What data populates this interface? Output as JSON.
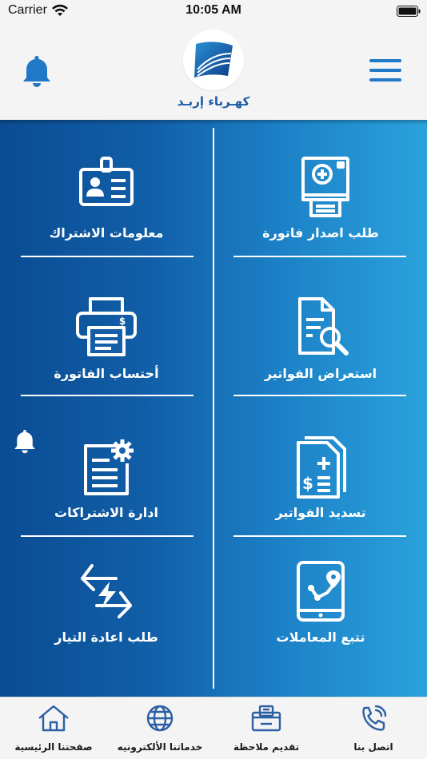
{
  "status_bar": {
    "carrier": "Carrier",
    "time": "10:05 AM"
  },
  "header": {
    "logo_text": "كهـرباء إربـد",
    "icons": [
      "notification-bell-icon",
      "hamburger-menu-icon",
      "company-logo"
    ]
  },
  "colors": {
    "accent": "#1f78c8",
    "panel_left": "#0a4c93",
    "panel_right": "#2aa2dc",
    "logo_blue": "#1b5aa8"
  },
  "services": {
    "request_invoice": {
      "label": "طلب اصدار فاتورة",
      "icon": "invoice-printer-add-icon"
    },
    "subscription_info": {
      "label": "معلومات الاشتراك",
      "icon": "id-card-icon"
    },
    "view_invoices": {
      "label": "استعراض الفواتير",
      "icon": "document-search-icon"
    },
    "calculate_invoice": {
      "label": "أحتساب الفاتورة",
      "icon": "printer-dollar-icon"
    },
    "pay_invoices": {
      "label": "تسديد الفواتير",
      "icon": "bill-payment-icon"
    },
    "manage_subscriptions": {
      "label": "ادارة الاشتراكات",
      "icon": "document-settings-icon"
    },
    "track_transactions": {
      "label": "تتبع المعاملات",
      "icon": "tablet-route-icon"
    },
    "reconnect_power": {
      "label": "طلب اعادة التيار",
      "icon": "power-reconnect-icon"
    }
  },
  "bottom_nav": {
    "contact": {
      "label": "اتصل بنا",
      "icon": "phone-icon"
    },
    "feedback": {
      "label": "تقديم ملاحظة",
      "icon": "feedback-box-icon"
    },
    "eservices": {
      "label": "خدماتنا الألكترونيه",
      "icon": "globe-icon"
    },
    "home": {
      "label": "صفحتنا الرئيسية",
      "icon": "home-icon"
    }
  }
}
